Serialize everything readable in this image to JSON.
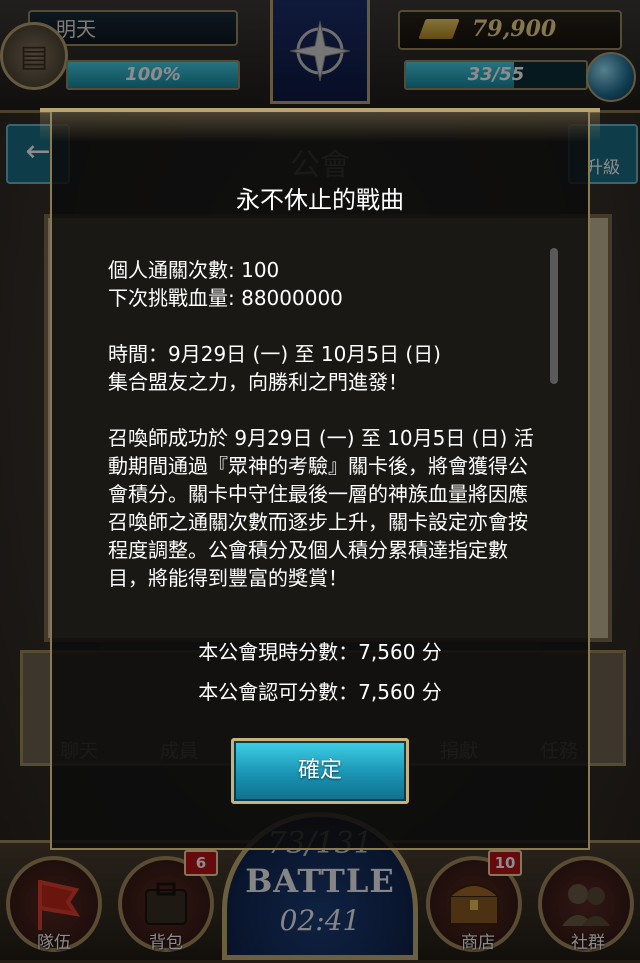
{
  "header": {
    "player_name": "明天",
    "hp_percent": 100,
    "hp_label": "100%",
    "gold": "79,900",
    "stamina": "33/55",
    "stamina_fraction": 0.6
  },
  "background": {
    "page_title": "公會",
    "upgrade_label": "升級",
    "tabs": [
      "聊天",
      "成員",
      "捐獻",
      "任務"
    ]
  },
  "dialog": {
    "title": "永不休止的戰曲",
    "lines": [
      "個人通關次數: 100",
      "下次挑戰血量: 88000000",
      "",
      "時間：9月29日 (一) 至 10月5日 (日)",
      "集合盟友之力，向勝利之門進發！",
      "",
      "召喚師成功於 9月29日 (一) 至 10月5日 (日) 活動期間通過『眾神的考驗』關卡後，將會獲得公會積分。關卡中守住最後一層的神族血量將因應召喚師之通關次數而逐步上升，關卡設定亦會按程度調整。公會積分及個人積分累積達指定數目，將能得到豐富的獎賞！"
    ],
    "guild_current_score": "本公會現時分數：7,560 分",
    "guild_approved_score": "本公會認可分數：7,560 分",
    "confirm_label": "確定"
  },
  "bottom_nav": {
    "team_label": "隊伍",
    "bag_label": "背包",
    "bag_badge": "6",
    "battle_count": "73/131",
    "battle_label": "BATTLE",
    "battle_timer": "02:41",
    "shop_label": "商店",
    "shop_badge": "10",
    "social_label": "社群"
  },
  "colors": {
    "accent_cyan": "#1a93b3",
    "frame_gold": "#b9a373",
    "badge_red": "#b8141a"
  }
}
